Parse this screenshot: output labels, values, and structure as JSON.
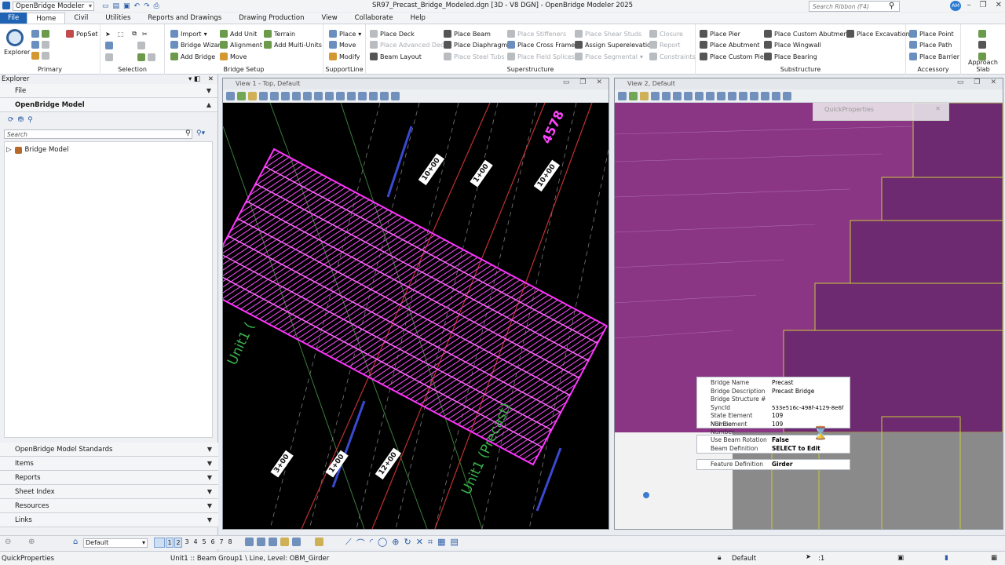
{
  "app": {
    "workspace": "OpenBridge Modeler",
    "doc_title": "SR97_Precast_Bridge_Modeled.dgn [3D - V8 DGN] - OpenBridge Modeler 2025",
    "search_placeholder": "Search Ribbon (F4)",
    "user_initials": "AM"
  },
  "tabs": [
    "File",
    "Home",
    "Civil",
    "Utilities",
    "Reports and Drawings",
    "Drawing Production",
    "View",
    "Collaborate",
    "Help"
  ],
  "ribbon": {
    "primary": {
      "caption": "Primary",
      "explorer": "Explorer",
      "popset": "PopSet"
    },
    "selection": {
      "caption": "Selection"
    },
    "bridge_setup": {
      "caption": "Bridge Setup",
      "import": "Import",
      "bridge_wizard": "Bridge Wizard",
      "add_bridge": "Add Bridge",
      "add_unit": "Add Unit",
      "alignment": "Alignment",
      "move": "Move",
      "terrain": "Terrain",
      "add_multi_units": "Add Multi-Units"
    },
    "supportline": {
      "caption": "SupportLine",
      "place": "Place",
      "move": "Move",
      "modify": "Modify"
    },
    "superstructure": {
      "caption": "Superstructure",
      "place_deck": "Place Deck",
      "place_advanced_deck": "Place Advanced Deck",
      "beam_layout": "Beam Layout",
      "place_beam": "Place Beam",
      "place_diaphragms": "Place Diaphragms",
      "place_steel_tubs": "Place Steel Tubs",
      "place_stiffeners": "Place Stiffeners",
      "place_cross_frames": "Place Cross Frames",
      "place_field_splices": "Place Field Splices",
      "place_shear_studs": "Place Shear Studs",
      "assign_superelevation": "Assign Superelevation",
      "place_segmental": "Place Segmental",
      "closure": "Closure",
      "report": "Report",
      "constraints": "Constraints"
    },
    "substructure": {
      "caption": "Substructure",
      "place_pier": "Place Pier",
      "place_abutment": "Place Abutment",
      "place_custom_pier": "Place Custom Pier",
      "place_custom_abutment": "Place Custom Abutment",
      "place_wingwall": "Place Wingwall",
      "place_bearing": "Place Bearing",
      "place_excavation": "Place Excavation"
    },
    "accessory": {
      "caption": "Accessory",
      "place_point": "Place Point",
      "place_path": "Place Path",
      "place_barrier": "Place Barrier"
    },
    "approach_slab": {
      "caption": "Approach Slab"
    }
  },
  "explorer": {
    "title": "Explorer",
    "file": "File",
    "model_section": "OpenBridge Model",
    "search_placeholder": "Search",
    "tree_root": "Bridge Model",
    "sections": [
      "OpenBridge Model Standards",
      "Items",
      "Reports",
      "Sheet Index",
      "Resources",
      "Links"
    ]
  },
  "view1": {
    "title": "View 1 - Top, Default",
    "stations": [
      "10+00",
      "1+00",
      "10+00",
      "3+00",
      "1+00",
      "12+00"
    ],
    "labels": [
      "Unit1 (Precast)",
      "Unit1 (",
      "4578"
    ]
  },
  "view2": {
    "title": "View 2, Default",
    "qp_title": "QuickProperties"
  },
  "quick_properties": {
    "rows": [
      {
        "label": "Bridge Name",
        "value": "Precast"
      },
      {
        "label": "Bridge Description",
        "value": "Precast Bridge"
      },
      {
        "label": "Bridge Structure #",
        "value": ""
      },
      {
        "label": "SyncId",
        "value": "533e516c-498f-4129-8e6f"
      },
      {
        "label": "State Element Number",
        "value": "109"
      },
      {
        "label": "NBI Element Number",
        "value": "109"
      }
    ],
    "rows2": [
      {
        "label": "Use Beam Rotation",
        "value": "False"
      },
      {
        "label": "Beam Definition",
        "value": "SELECT to Edit"
      }
    ],
    "rows3": [
      {
        "label": "Feature Definition",
        "value": "Girder"
      }
    ]
  },
  "bottombar": {
    "default_model": "Default",
    "view_numbers": [
      "1",
      "2",
      "3",
      "4",
      "5",
      "6",
      "7",
      "8"
    ]
  },
  "statusbar": {
    "left": "QuickProperties",
    "message": "Unit1 :: Beam Group1 \\ Line, Level: OBM_Girder",
    "level": "Default",
    "snap": ":1"
  }
}
